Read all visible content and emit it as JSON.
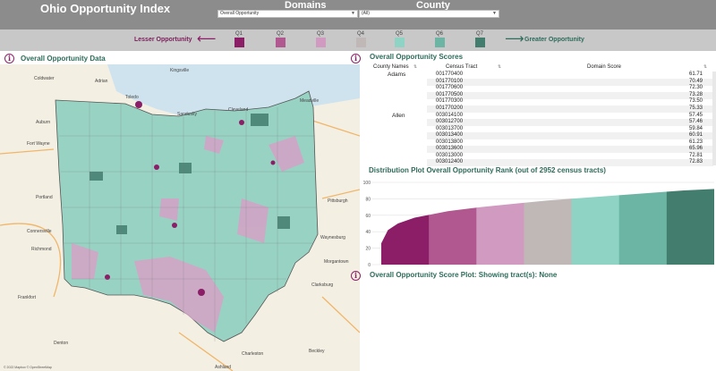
{
  "header": {
    "title": "Ohio Opportunity Index",
    "domains_label": "Domains",
    "county_label": "County",
    "domain_select": "Overall Opportunity",
    "county_select": "(All)"
  },
  "legend": {
    "lesser": "Lesser Opportunity",
    "greater": "Greater Opportunity",
    "quintiles": [
      {
        "label": "Q1",
        "color": "#8c1e68"
      },
      {
        "label": "Q2",
        "color": "#b0588f"
      },
      {
        "label": "Q3",
        "color": "#d19ac0"
      },
      {
        "label": "Q4",
        "color": "#bfb8b6"
      },
      {
        "label": "Q5",
        "color": "#8ed3c3"
      },
      {
        "label": "Q6",
        "color": "#6cb5a5"
      },
      {
        "label": "Q7",
        "color": "#427d6e"
      }
    ]
  },
  "map": {
    "title": "Overall Opportunity Data",
    "attribution": "© 2022 Mapbox © OpenStreetMap",
    "cities": [
      "Kingsville",
      "Coldwater",
      "Adrian",
      "Toledo",
      "Sandusky",
      "Cleveland",
      "Meadville",
      "Auburn",
      "Fort Wayne",
      "Portland",
      "Connersville",
      "Richmond",
      "Pittsburgh",
      "Waynesburg",
      "Morgantown",
      "Clarksburg",
      "Charleston",
      "Beckley",
      "Denton",
      "Ashland",
      "Frankfort"
    ]
  },
  "scores": {
    "title": "Overall Opportunity Scores",
    "col_county": "County Names",
    "col_tract": "Census Tract",
    "col_score": "Domain Score",
    "counties": [
      {
        "name": "Adams",
        "rows": [
          {
            "tract": "001770400",
            "score": "61.71"
          },
          {
            "tract": "001770100",
            "score": "70.49"
          },
          {
            "tract": "001770600",
            "score": "72.30"
          },
          {
            "tract": "001770500",
            "score": "73.28"
          },
          {
            "tract": "001770300",
            "score": "73.50"
          },
          {
            "tract": "001770200",
            "score": "75.33"
          }
        ]
      },
      {
        "name": "Allen",
        "rows": [
          {
            "tract": "003014100",
            "score": "57.45"
          },
          {
            "tract": "003012700",
            "score": "57.46"
          },
          {
            "tract": "003013700",
            "score": "59.84"
          },
          {
            "tract": "003013400",
            "score": "60.91"
          },
          {
            "tract": "003013800",
            "score": "61.23"
          },
          {
            "tract": "003013600",
            "score": "65.96"
          },
          {
            "tract": "003013000",
            "score": "72.81"
          },
          {
            "tract": "003012400",
            "score": "72.83"
          }
        ]
      }
    ]
  },
  "distribution": {
    "title": "Distribution Plot Overall Opportunity Rank (out of 2952 census tracts)",
    "chart_data": {
      "type": "area",
      "title": "Distribution Plot Overall Opportunity Rank (out of 2952 census tracts)",
      "xlabel": "",
      "ylabel": "",
      "ylim": [
        0,
        100
      ],
      "yticks": [
        0,
        20,
        40,
        60,
        80,
        100
      ],
      "x": [
        0,
        0.02,
        0.05,
        0.1,
        0.2,
        0.3,
        0.4,
        0.5,
        0.6,
        0.7,
        0.8,
        0.9,
        1.0
      ],
      "y": [
        26,
        42,
        50,
        57,
        65,
        70,
        74,
        78,
        81,
        84,
        87,
        90,
        92
      ],
      "bands": [
        {
          "label": "Q1",
          "color": "#8c1e68"
        },
        {
          "label": "Q2",
          "color": "#b0588f"
        },
        {
          "label": "Q3",
          "color": "#d19ac0"
        },
        {
          "label": "Q4",
          "color": "#bfb8b6"
        },
        {
          "label": "Q5",
          "color": "#8ed3c3"
        },
        {
          "label": "Q6",
          "color": "#6cb5a5"
        },
        {
          "label": "Q7",
          "color": "#427d6e"
        }
      ],
      "grid": true
    }
  },
  "score_plot": {
    "title": "Overall Opportunity Score Plot: Showing tract(s): None"
  }
}
